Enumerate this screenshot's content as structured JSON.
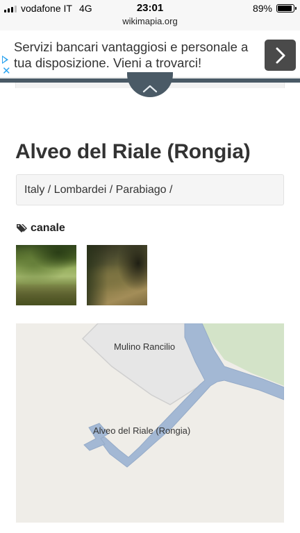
{
  "status_bar": {
    "carrier": "vodafone IT",
    "network": "4G",
    "time": "23:01",
    "battery_percent": "89%",
    "battery_level": 0.89
  },
  "browser": {
    "url": "wikimapia.org"
  },
  "ad": {
    "text": "Servizi bancari vantaggiosi e personale a tua disposizione. Vieni a trovarci!",
    "close_symbol": "✕"
  },
  "place": {
    "title": "Alveo del Riale (Rongia)",
    "breadcrumb": "Italy / Lombardei / Parabiago /",
    "tag": "canale"
  },
  "map": {
    "labels": {
      "mulino": "Mulino Rancilio",
      "alveo": "Alveo del Riale (Rongia)"
    },
    "colors": {
      "background": "#efede8",
      "water": "#a3b8d4",
      "water_stroke": "#95abc8",
      "park": "#d3e3c8",
      "area": "#e6e6e6"
    }
  },
  "icons": {
    "ad_play": "ad-choices-play-icon",
    "ad_close": "close-icon",
    "ad_arrow": "chevron-right-icon",
    "toggle": "chevron-up-icon",
    "tag": "tags-icon"
  }
}
